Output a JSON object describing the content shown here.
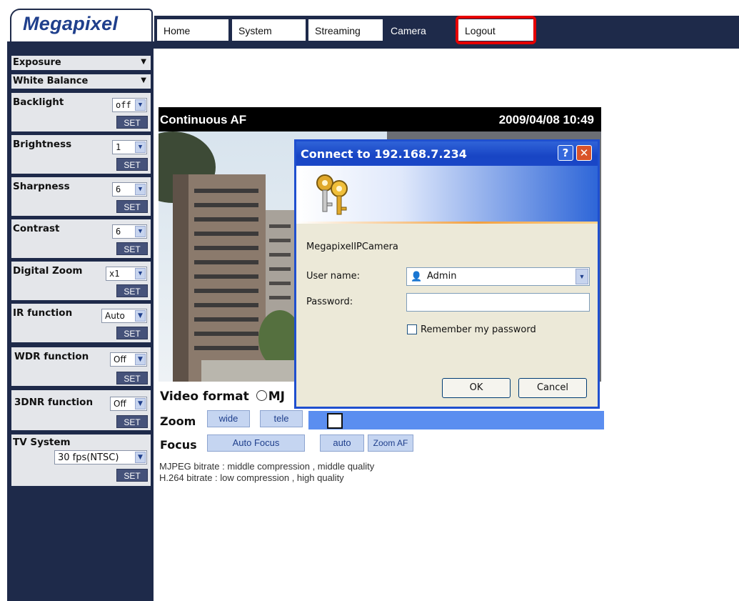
{
  "header": {
    "logo": "Megapixel",
    "nav": [
      "Home",
      "System",
      "Streaming",
      "Camera",
      "Logout"
    ],
    "active_tab": "Camera",
    "highlighted_tab": "Logout",
    "highlight_color": "#e60000"
  },
  "sidebar": {
    "sections": [
      {
        "label": "Exposure"
      },
      {
        "label": "White Balance"
      }
    ],
    "settings": [
      {
        "label": "Backlight",
        "value": "off",
        "button": "SET"
      },
      {
        "label": "Brightness",
        "value": "1",
        "button": "SET"
      },
      {
        "label": "Sharpness",
        "value": "6",
        "button": "SET"
      },
      {
        "label": "Contrast",
        "value": "6",
        "button": "SET"
      },
      {
        "label": "Digital Zoom",
        "value": "x1",
        "button": "SET"
      },
      {
        "label": "IR function",
        "value": "Auto",
        "button": "SET"
      },
      {
        "label": "WDR function",
        "value": "Off",
        "button": "SET"
      },
      {
        "label": "3DNR function",
        "value": "Off",
        "button": "SET"
      },
      {
        "label": "TV System",
        "value": "30 fps(NTSC)",
        "button": "SET"
      }
    ]
  },
  "video": {
    "overlay_left": "Continuous AF",
    "overlay_right": "2009/04/08 10:49",
    "format_label": "Video format",
    "format_option": "MJ",
    "zoom_label": "Zoom",
    "zoom_wide": "wide",
    "zoom_tele": "tele",
    "focus_label": "Focus",
    "focus_auto": "Auto Focus",
    "focus_mode": "auto",
    "focus_zoom_af": "Zoom AF",
    "info_lines": [
      "MJPEG bitrate : middle compression , middle quality",
      "H.264 bitrate : low compression , high quality"
    ]
  },
  "dialog": {
    "title": "Connect to 192.168.7.234",
    "help_glyph": "?",
    "close_glyph": "✕",
    "realm": "MegapixelIPCamera",
    "username_label": "User name:",
    "username_value": "Admin",
    "password_label": "Password:",
    "password_value": "",
    "remember_label": "Remember my password",
    "remember_checked": false,
    "ok": "OK",
    "cancel": "Cancel"
  },
  "colors": {
    "nav_dark": "#1e2a4a",
    "set_button": "#45527a",
    "dialog_title": "#1f4fcf",
    "zoom_bar": "#5b8ef0"
  }
}
